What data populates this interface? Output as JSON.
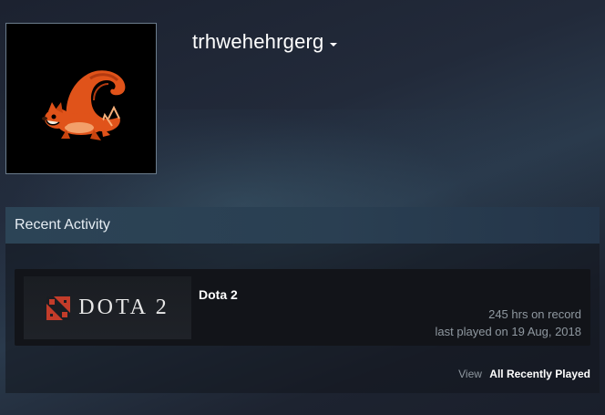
{
  "profile": {
    "username": "trhwehehrgerg",
    "avatar_icon": "squirrel-avatar-icon",
    "dropdown_icon": "caret-down-icon"
  },
  "recent_activity": {
    "title": "Recent Activity",
    "games": [
      {
        "name": "Dota 2",
        "logo_text": "DOTA 2",
        "logo_icon": "dota-emblem-icon",
        "hours": "245 hrs on record",
        "last_played": "last played on 19 Aug, 2018"
      }
    ],
    "footer": {
      "view_label": "View",
      "all_label": "All Recently Played"
    }
  },
  "colors": {
    "username": "#ffffff",
    "header_bg": "#2c4456",
    "muted_text": "#8f98a0",
    "dota_red": "#c23c2a",
    "squirrel_orange": "#e0531a"
  }
}
